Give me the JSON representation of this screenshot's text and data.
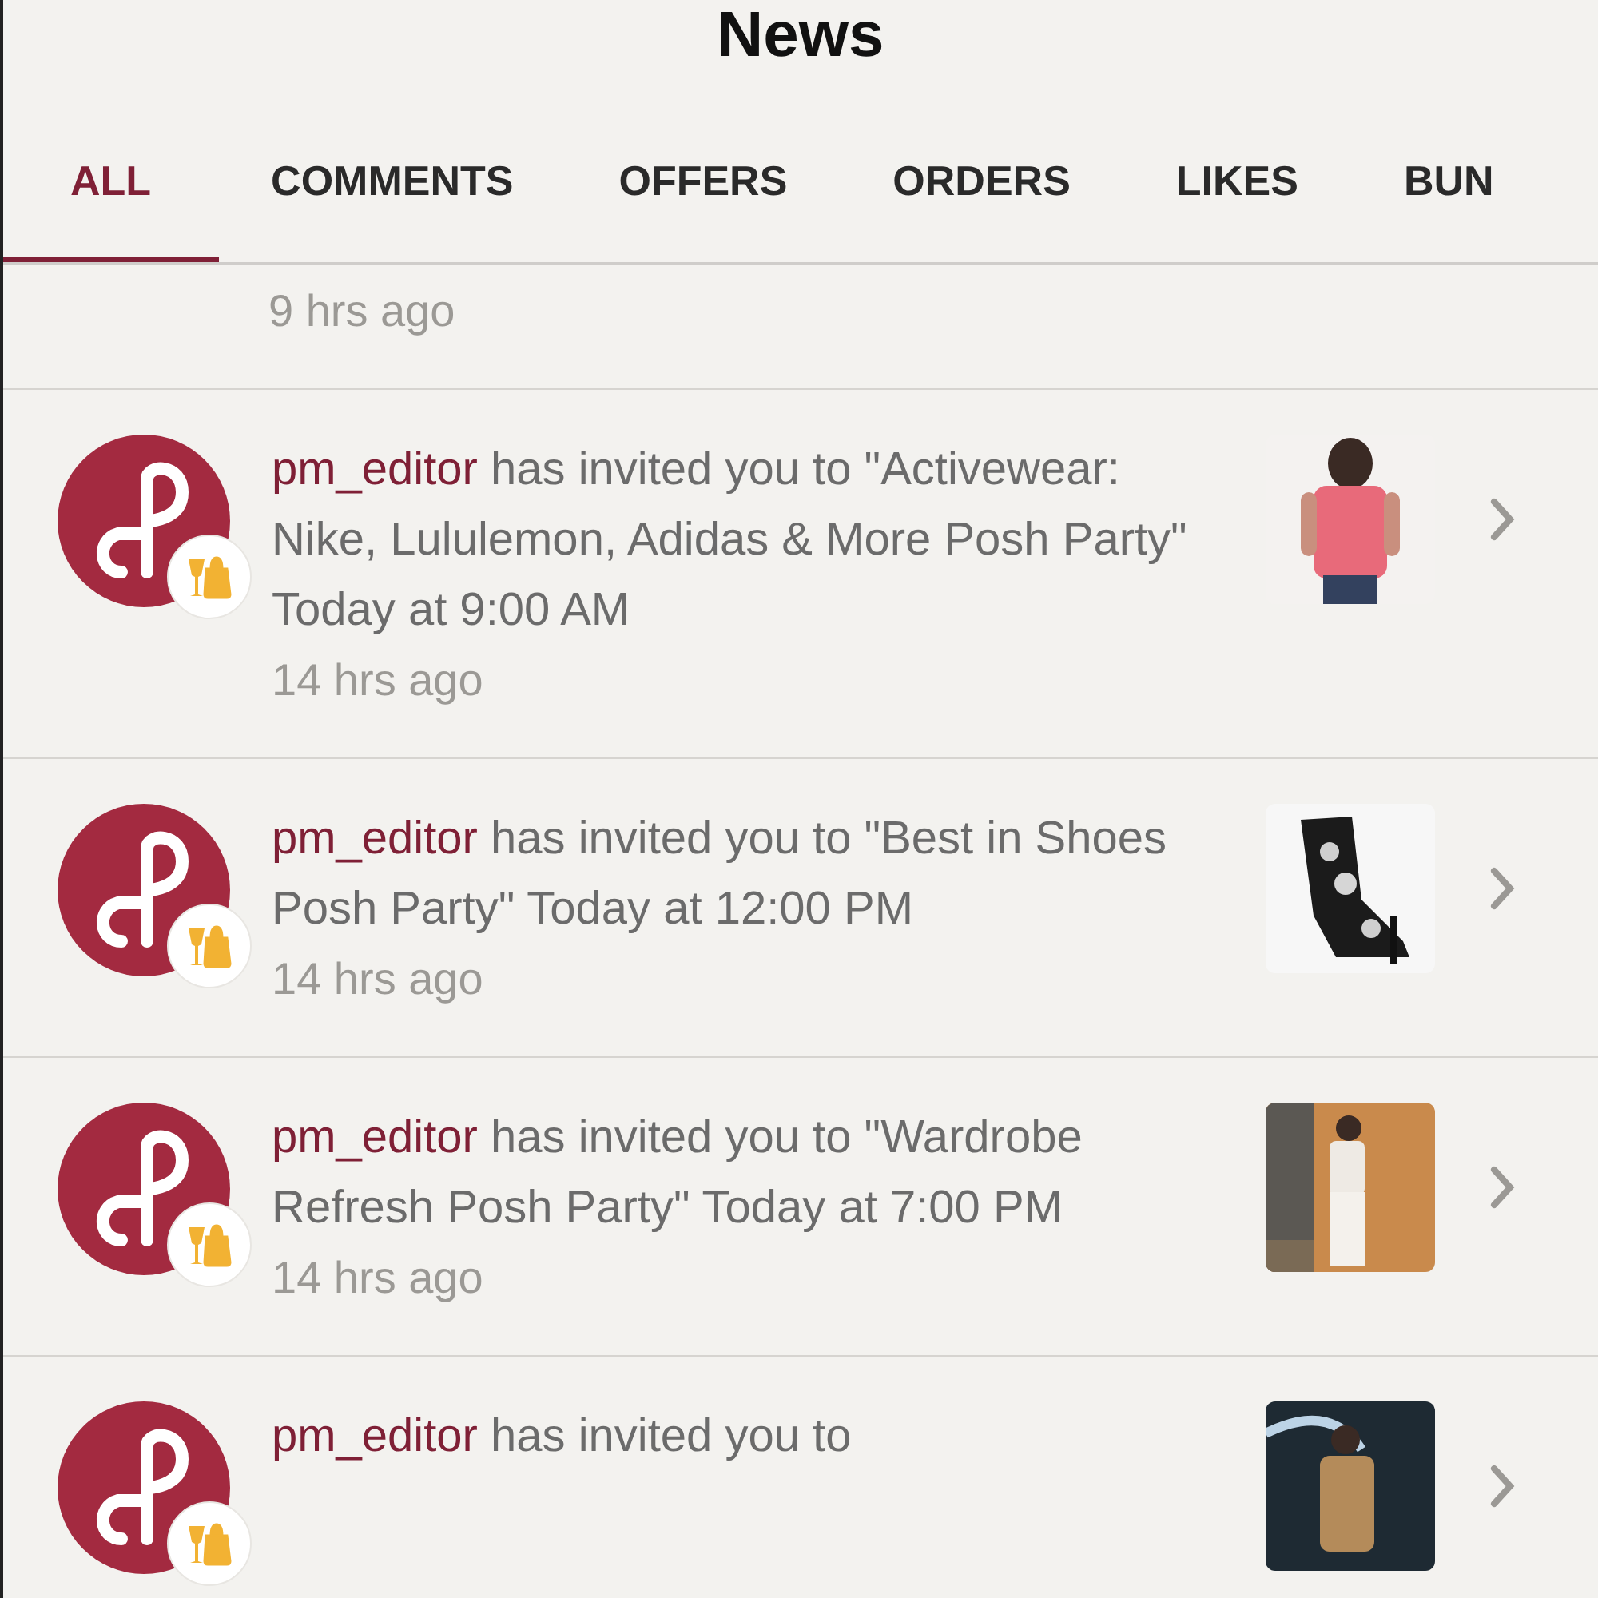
{
  "header": {
    "title": "News"
  },
  "tabs": [
    {
      "label": "ALL",
      "selected": true
    },
    {
      "label": "COMMENTS",
      "selected": false
    },
    {
      "label": "OFFERS",
      "selected": false
    },
    {
      "label": "ORDERS",
      "selected": false
    },
    {
      "label": "LIKES",
      "selected": false
    },
    {
      "label": "BUN",
      "selected": false
    }
  ],
  "partial_item": {
    "time": "9 hrs ago"
  },
  "items": [
    {
      "user": "pm_editor",
      "text": "has invited you to \"Activewear: Nike, Lululemon, Adidas & More Posh Party\" Today at 9:00 AM",
      "time": "14 hrs ago"
    },
    {
      "user": "pm_editor",
      "text": "has invited you to \"Best in Shoes Posh Party\" Today at 12:00 PM",
      "time": "14 hrs ago"
    },
    {
      "user": "pm_editor",
      "text": "has invited you to \"Wardrobe Refresh Posh Party\" Today at 7:00 PM",
      "time": "14 hrs ago"
    },
    {
      "user": "pm_editor",
      "text": "has invited you to"
    }
  ]
}
